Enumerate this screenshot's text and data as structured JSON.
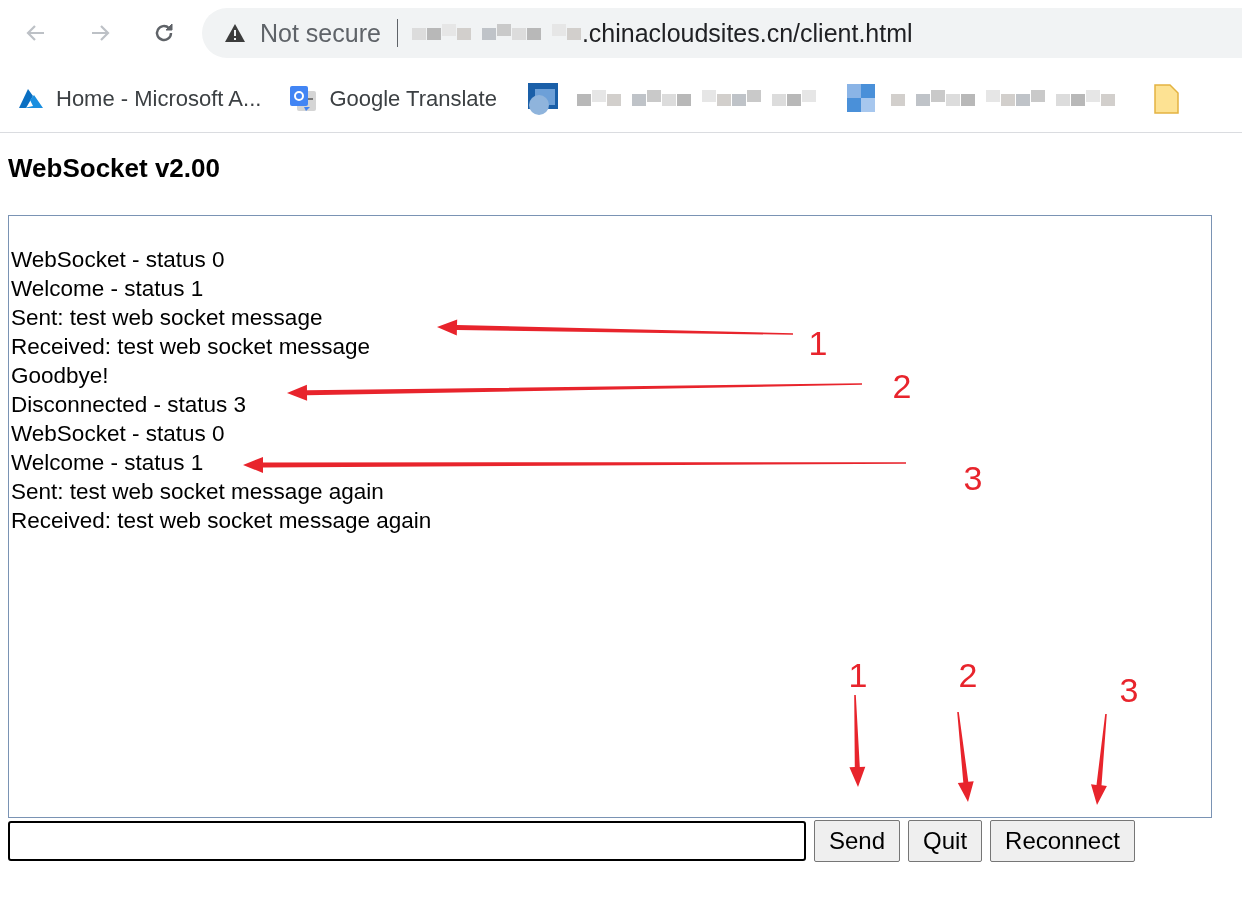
{
  "browser": {
    "back_disabled": true,
    "forward_disabled": true,
    "security": "Not secure",
    "url": ".chinacloudsites.cn/client.html"
  },
  "bookmarks": [
    {
      "kind": "azure",
      "label": "Home - Microsoft A..."
    },
    {
      "kind": "translate",
      "label": "Google Translate"
    },
    {
      "kind": "blurred"
    },
    {
      "kind": "blurred-alt"
    },
    {
      "kind": "folder"
    }
  ],
  "page": {
    "title": "WebSocket v2.00",
    "log": [
      "WebSocket - status 0",
      "Welcome - status 1",
      "Sent: test web socket message",
      "Received: test web socket message",
      "Goodbye!",
      "Disconnected - status 3",
      "WebSocket - status 0",
      "Welcome - status 1",
      "Sent: test web socket message again",
      "Received: test web socket message again"
    ],
    "buttons": [
      "Send",
      "Quit",
      "Reconnect"
    ]
  },
  "annotations": [
    {
      "label": "1"
    },
    {
      "label": "2"
    },
    {
      "label": "3"
    },
    {
      "label": "1"
    },
    {
      "label": "2"
    },
    {
      "label": "3"
    }
  ]
}
